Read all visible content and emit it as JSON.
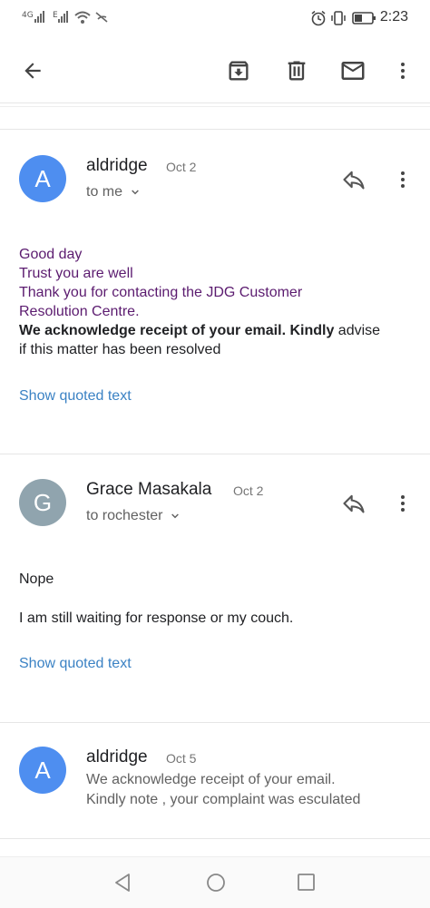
{
  "status": {
    "signal1": "4G",
    "signal2": "E",
    "time": "2:23"
  },
  "messages": [
    {
      "sender": "aldridge",
      "date": "Oct 2",
      "to": "to me",
      "avatar_letter": "A",
      "avatar_color": "#4e8ef0",
      "body": {
        "line1": "Good day",
        "line2": "Trust you are well",
        "line3": "Thank you for contacting the JDG Customer",
        "line4": "Resolution Centre.",
        "line5_bold": "We acknowledge receipt of your email. Kindly",
        "line5_rest": " advise",
        "line6": "if this matter has been resolved"
      },
      "show_quoted": "Show quoted text"
    },
    {
      "sender": "Grace Masakala",
      "date": "Oct 2",
      "to": "to rochester",
      "avatar_letter": "G",
      "avatar_color": "#90a4ae",
      "body": {
        "line1": "Nope",
        "line2": "I am still waiting for response or my couch."
      },
      "show_quoted": "Show quoted text"
    },
    {
      "sender": "aldridge",
      "date": "Oct 5",
      "avatar_letter": "A",
      "avatar_color": "#4e8ef0",
      "snippet1": "We acknowledge receipt of your email.",
      "snippet2": "Kindly note , your complaint was esculated"
    }
  ],
  "icons": {
    "back": "arrow-left-icon",
    "archive": "archive-icon",
    "delete": "trash-icon",
    "mail": "mail-icon",
    "more": "more-vert-icon",
    "reply": "reply-icon"
  }
}
